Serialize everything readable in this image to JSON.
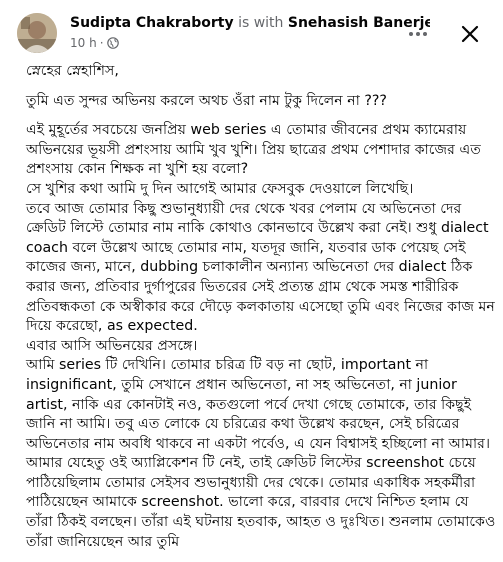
{
  "post": {
    "author": "Sudipta Chakraborty",
    "connector": "is with",
    "tagged": "Snehasish Banerjee.",
    "time": "10 h",
    "separator": "·",
    "audience_icon": "globe-icon",
    "more_icon": "more-options-icon",
    "close_icon": "close-icon"
  },
  "content": {
    "greeting": "স্নেহের স্নেহাশিস,",
    "line_question": "তুমি এত সুন্দর অভিনয় করলে অথচ ওঁরা নাম টুকু দিলেন না ???",
    "para1": "এই মুহূর্তের সবচেয়ে জনপ্রিয় web series এ তোমার জীবনের প্রথম ক্যামেরায় অভিনয়ের ভূয়সী প্রশংসায় আমি খুব খুশি। প্রিয় ছাত্রের প্রথম পেশাদার কাজের এত প্রশংসায় কোন শিক্ষক না খুশি হয় বলো?",
    "para2": "সে খুশির কথা আমি দু দিন আগেই আমার ফেসবুক দেওয়ালে লিখেছি।",
    "para3": "তবে আজ তোমার কিছু শুভানুধ্যায়ী দের থেকে খবর পেলাম যে অভিনেতা দের ক্রেডিট লিস্টে তোমার নাম নাকি কোথাও কোনভাবে উল্লেখ করা নেই। শুধু dialect coach বলে উল্লেখ আছে তোমার নাম, যতদূর জানি, যতবার ডাক পেয়েছ সেই কাজের জন্য, মানে, dubbing চলাকালীন অন্যান্য অভিনেতা দের dialect ঠিক করার জন্য, প্রতিবার দুর্গাপুরের ভিতরের সেই প্রত্যন্ত গ্রাম থেকে সমস্ত শারীরিক প্রতিবন্ধকতা কে অস্বীকার করে দৌড়ে কলকাতায় এসেছো তুমি এবং নিজের কাজ মন দিয়ে করেছো, as expected.",
    "para4": "এবার আসি অভিনয়ের প্রসঙ্গে।",
    "para5": "আমি series টি দেখিনি। তোমার চরিত্র টি বড় না ছোট, important না insignificant, তুমি সেখানে প্রধান অভিনেতা, না সহ অভিনেতা, না junior artist, নাকি এর কোনটাই নও, কতগুলো পর্বে দেখা গেছে তোমাকে, তার কিছুই জানি না আমি। তবু এত লোকে যে চরিত্রের কথা উল্লেখ করছেন, সেই চরিত্রের অভিনেতার নাম অবধি থাকবে না একটা পর্বেও, এ যেন বিশ্বাসই হচ্ছিলো না আমার। আমার যেহেতু ওই অ্যাপ্লিকেশন টি নেই, তাই ক্রেডিট লিস্টের screenshot চেয়ে পাঠিয়েছিলাম তোমার সেইসব শুভানুধ্যায়ী দের থেকে। তোমার একাধিক সহকর্মীরা পাঠিয়েছেন আমাকে screenshot. ভালো করে, বারবার দেখে নিশ্চিত হলাম যে তাঁরা ঠিকই বলছেন। তাঁরা এই ঘটনায় হতবাক, আহত ও দুঃখিত। শুনলাম তোমাকেও তাঁরা জানিয়েছেন আর তুমি"
  }
}
